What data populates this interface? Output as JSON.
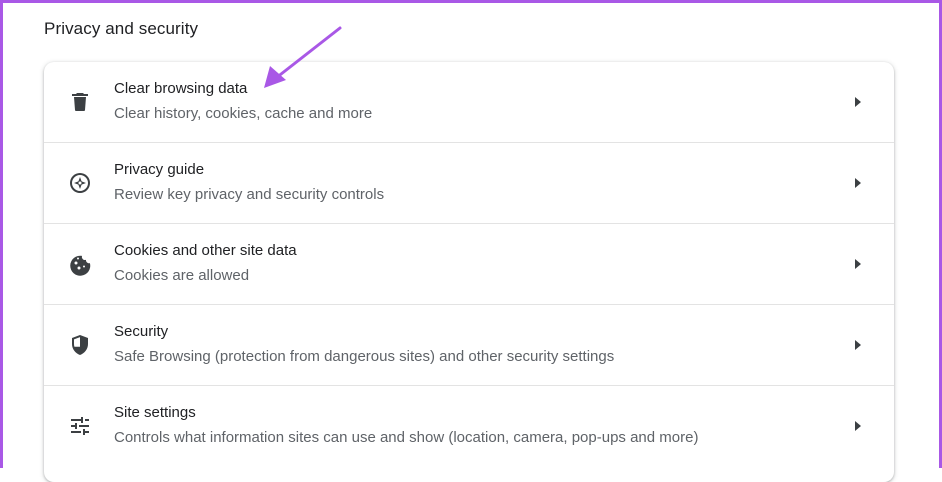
{
  "section": {
    "title": "Privacy and security"
  },
  "rows": [
    {
      "title": "Clear browsing data",
      "subtitle": "Clear history, cookies, cache and more",
      "icon": "trash-icon"
    },
    {
      "title": "Privacy guide",
      "subtitle": "Review key privacy and security controls",
      "icon": "compass-icon"
    },
    {
      "title": "Cookies and other site data",
      "subtitle": "Cookies are allowed",
      "icon": "cookie-icon"
    },
    {
      "title": "Security",
      "subtitle": "Safe Browsing (protection from dangerous sites) and other security settings",
      "icon": "shield-icon"
    },
    {
      "title": "Site settings",
      "subtitle": "Controls what information sites can use and show (location, camera, pop-ups and more)",
      "icon": "sliders-icon"
    }
  ],
  "colors": {
    "accent_arrow": "#a958e6",
    "frame": "#a958e6",
    "text": "#202124",
    "subtext": "#5f6368",
    "icon": "#3c4043"
  }
}
